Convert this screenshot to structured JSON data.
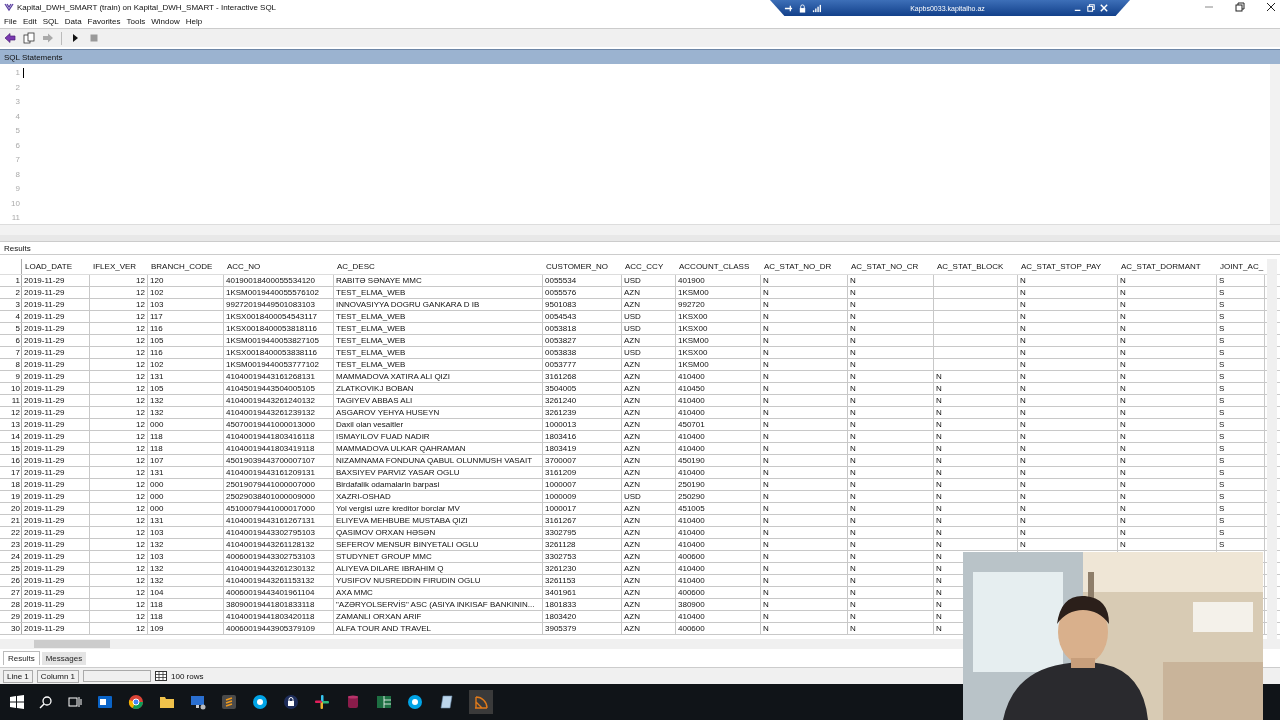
{
  "window": {
    "title": "Kapital_DWH_SMART (train) on Kapital_DWH_SMART - Interactive SQL"
  },
  "remote_bar": {
    "host": "Kapbs0033.kapitalho.az"
  },
  "menu": [
    "File",
    "Edit",
    "SQL",
    "Data",
    "Favorites",
    "Tools",
    "Window",
    "Help"
  ],
  "sql_panel": {
    "title": "SQL Statements",
    "line_numbers": [
      "1",
      "2",
      "3",
      "4",
      "5",
      "6",
      "7",
      "8",
      "9",
      "10",
      "11"
    ]
  },
  "results_panel": {
    "title": "Results",
    "columns": [
      {
        "label": "LOAD_DATE",
        "kind": "text"
      },
      {
        "label": "IFLEX_VER",
        "kind": "number"
      },
      {
        "label": "BRANCH_CODE",
        "kind": "text"
      },
      {
        "label": "ACC_NO",
        "kind": "text"
      },
      {
        "label": "AC_DESC",
        "kind": "text"
      },
      {
        "label": "CUSTOMER_NO",
        "kind": "text"
      },
      {
        "label": "ACC_CCY",
        "kind": "text"
      },
      {
        "label": "ACCOUNT_CLASS",
        "kind": "text"
      },
      {
        "label": "AC_STAT_NO_DR",
        "kind": "text"
      },
      {
        "label": "AC_STAT_NO_CR",
        "kind": "text"
      },
      {
        "label": "AC_STAT_BLOCK",
        "kind": "text"
      },
      {
        "label": "AC_STAT_STOP_PAY",
        "kind": "text"
      },
      {
        "label": "AC_STAT_DORMANT",
        "kind": "text"
      },
      {
        "label": "JOINT_AC_",
        "kind": "text"
      }
    ],
    "rows": [
      {
        "n": "1",
        "cells": [
          "2019-11-29",
          "12",
          "120",
          "40190018400055534120",
          "RABITƏ SƏNAYE MMC",
          "0055534",
          "USD",
          "401900",
          "N",
          "N",
          "",
          "N",
          "N",
          "S"
        ]
      },
      {
        "n": "2",
        "cells": [
          "2019-11-29",
          "12",
          "102",
          "1KSM0019440055576102",
          "TEST_ELMA_WEB",
          "0055576",
          "AZN",
          "1KSM00",
          "N",
          "N",
          "",
          "N",
          "N",
          "S"
        ]
      },
      {
        "n": "3",
        "cells": [
          "2019-11-29",
          "12",
          "103",
          "99272019449501083103",
          "INNOVASIYYA DOGRU  GANKARA D IB",
          "9501083",
          "AZN",
          "992720",
          "N",
          "N",
          "",
          "N",
          "N",
          "S"
        ]
      },
      {
        "n": "4",
        "cells": [
          "2019-11-29",
          "12",
          "117",
          "1KSX0018400054543117",
          "TEST_ELMA_WEB",
          "0054543",
          "USD",
          "1KSX00",
          "N",
          "N",
          "",
          "N",
          "N",
          "S"
        ]
      },
      {
        "n": "5",
        "cells": [
          "2019-11-29",
          "12",
          "116",
          "1KSX0018400053818116",
          "TEST_ELMA_WEB",
          "0053818",
          "USD",
          "1KSX00",
          "N",
          "N",
          "",
          "N",
          "N",
          "S"
        ]
      },
      {
        "n": "6",
        "cells": [
          "2019-11-29",
          "12",
          "105",
          "1KSM0019440053827105",
          "TEST_ELMA_WEB",
          "0053827",
          "AZN",
          "1KSM00",
          "N",
          "N",
          "",
          "N",
          "N",
          "S"
        ]
      },
      {
        "n": "7",
        "cells": [
          "2019-11-29",
          "12",
          "116",
          "1KSX0018400053838116",
          "TEST_ELMA_WEB",
          "0053838",
          "USD",
          "1KSX00",
          "N",
          "N",
          "",
          "N",
          "N",
          "S"
        ]
      },
      {
        "n": "8",
        "cells": [
          "2019-11-29",
          "12",
          "102",
          "1KSM0019440053777102",
          "TEST_ELMA_WEB",
          "0053777",
          "AZN",
          "1KSM00",
          "N",
          "N",
          "",
          "N",
          "N",
          "S"
        ]
      },
      {
        "n": "9",
        "cells": [
          "2019-11-29",
          "12",
          "131",
          "41040019443161268131",
          "MAMMADOVA XATIRA ALI QIZI",
          "3161268",
          "AZN",
          "410400",
          "N",
          "N",
          "N",
          "N",
          "N",
          "S"
        ]
      },
      {
        "n": "10",
        "cells": [
          "2019-11-29",
          "12",
          "105",
          "41045019443504005105",
          "ZLATKOVIKJ BOBAN",
          "3504005",
          "AZN",
          "410450",
          "N",
          "N",
          "N",
          "N",
          "N",
          "S"
        ]
      },
      {
        "n": "11",
        "cells": [
          "2019-11-29",
          "12",
          "132",
          "41040019443261240132",
          "TAGIYEV ABBAS ALI",
          "3261240",
          "AZN",
          "410400",
          "N",
          "N",
          "N",
          "N",
          "N",
          "S"
        ]
      },
      {
        "n": "12",
        "cells": [
          "2019-11-29",
          "12",
          "132",
          "41040019443261239132",
          "ASGAROV YEHYA HUSEYN",
          "3261239",
          "AZN",
          "410400",
          "N",
          "N",
          "N",
          "N",
          "N",
          "S"
        ]
      },
      {
        "n": "13",
        "cells": [
          "2019-11-29",
          "12",
          "000",
          "45070019441000013000",
          "Daxil olan vesaitler",
          "1000013",
          "AZN",
          "450701",
          "N",
          "N",
          "N",
          "N",
          "N",
          "S"
        ]
      },
      {
        "n": "14",
        "cells": [
          "2019-11-29",
          "12",
          "118",
          "41040019441803416118",
          "ISMAYILOV FUAD NADIR",
          "1803416",
          "AZN",
          "410400",
          "N",
          "N",
          "N",
          "N",
          "N",
          "S"
        ]
      },
      {
        "n": "15",
        "cells": [
          "2019-11-29",
          "12",
          "118",
          "41040019441803419118",
          "MAMMADOVA ULKAR QAHRAMAN",
          "1803419",
          "AZN",
          "410400",
          "N",
          "N",
          "N",
          "N",
          "N",
          "S"
        ]
      },
      {
        "n": "16",
        "cells": [
          "2019-11-29",
          "12",
          "107",
          "45019039443700007107",
          "NIZAMNAMA FONDUNA QABUL OLUNMUSH  VASAIT",
          "3700007",
          "AZN",
          "450190",
          "N",
          "N",
          "N",
          "N",
          "N",
          "S"
        ]
      },
      {
        "n": "17",
        "cells": [
          "2019-11-29",
          "12",
          "131",
          "41040019443161209131",
          "BAXSIYEV PARVIZ YASAR OGLU",
          "3161209",
          "AZN",
          "410400",
          "N",
          "N",
          "N",
          "N",
          "N",
          "S"
        ]
      },
      {
        "n": "18",
        "cells": [
          "2019-11-29",
          "12",
          "000",
          "25019079441000007000",
          "Birdafalik odamalarin barpasi",
          "1000007",
          "AZN",
          "250190",
          "N",
          "N",
          "N",
          "N",
          "N",
          "S"
        ]
      },
      {
        "n": "19",
        "cells": [
          "2019-11-29",
          "12",
          "000",
          "25029038401000009000",
          "XAZRI-OSHAD",
          "1000009",
          "USD",
          "250290",
          "N",
          "N",
          "N",
          "N",
          "N",
          "S"
        ]
      },
      {
        "n": "20",
        "cells": [
          "2019-11-29",
          "12",
          "000",
          "45100079441000017000",
          "Yol vergisi uzre kreditor borclar MV",
          "1000017",
          "AZN",
          "451005",
          "N",
          "N",
          "N",
          "N",
          "N",
          "S"
        ]
      },
      {
        "n": "21",
        "cells": [
          "2019-11-29",
          "12",
          "131",
          "41040019443161267131",
          "ELIYEVA MEHBUBE MUSTABA QIZI",
          "3161267",
          "AZN",
          "410400",
          "N",
          "N",
          "N",
          "N",
          "N",
          "S"
        ]
      },
      {
        "n": "22",
        "cells": [
          "2019-11-29",
          "12",
          "103",
          "41040019443302795103",
          "QASIMOV ORXAN HƏSƏN",
          "3302795",
          "AZN",
          "410400",
          "N",
          "N",
          "N",
          "N",
          "N",
          "S"
        ]
      },
      {
        "n": "23",
        "cells": [
          "2019-11-29",
          "12",
          "132",
          "41040019443261128132",
          "SEFEROV MENSUR BINYETALI OGLU",
          "3261128",
          "AZN",
          "410400",
          "N",
          "N",
          "N",
          "N",
          "N",
          "S"
        ]
      },
      {
        "n": "24",
        "cells": [
          "2019-11-29",
          "12",
          "103",
          "40060019443302753103",
          "STUDYNET GROUP MMC",
          "3302753",
          "AZN",
          "400600",
          "N",
          "N",
          "N"
        ]
      },
      {
        "n": "25",
        "cells": [
          "2019-11-29",
          "12",
          "132",
          "41040019443261230132",
          "ALIYEVA DILARE IBRAHIM Q",
          "3261230",
          "AZN",
          "410400",
          "N",
          "N",
          "N"
        ]
      },
      {
        "n": "26",
        "cells": [
          "2019-11-29",
          "12",
          "132",
          "41040019443261153132",
          "YUSIFOV NUSREDDIN FIRUDIN OGLU",
          "3261153",
          "AZN",
          "410400",
          "N",
          "N",
          "N"
        ]
      },
      {
        "n": "27",
        "cells": [
          "2019-11-29",
          "12",
          "104",
          "40060019443401961104",
          "AXA MMC",
          "3401961",
          "AZN",
          "400600",
          "N",
          "N",
          "N"
        ]
      },
      {
        "n": "28",
        "cells": [
          "2019-11-29",
          "12",
          "118",
          "38090019441801833118",
          "\"AZƏRYOLSERVİS\" ASC (ASIYA INKISAF BANKININ...",
          "1801833",
          "AZN",
          "380900",
          "N",
          "N",
          "N"
        ]
      },
      {
        "n": "29",
        "cells": [
          "2019-11-29",
          "12",
          "118",
          "41040019441803420118",
          "ZAMANLI ORXAN ARIF",
          "1803420",
          "AZN",
          "410400",
          "N",
          "N",
          "N"
        ]
      },
      {
        "n": "30",
        "cells": [
          "2019-11-29",
          "12",
          "109",
          "40060019443905379109",
          "ALFA TOUR AND TRAVEL",
          "3905379",
          "AZN",
          "400600",
          "N",
          "N",
          "N"
        ]
      }
    ]
  },
  "bottom_tabs": [
    {
      "label": "Results",
      "selected": true
    },
    {
      "label": "Messages",
      "selected": false
    }
  ],
  "status_bar": {
    "line": "Line 1",
    "column": "Column 1",
    "rows": "100 rows"
  }
}
